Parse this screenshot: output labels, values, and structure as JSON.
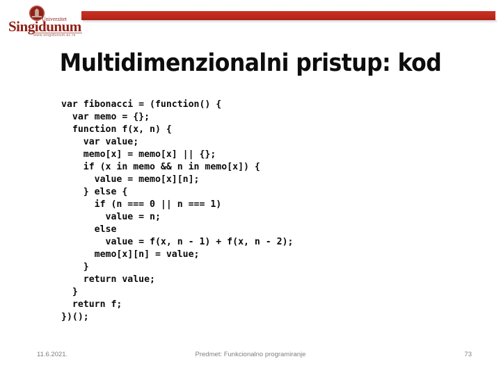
{
  "slide": {
    "title": "Multidimenzionalni pristup: kod",
    "accent_color": "#bf2a1d",
    "background_color": "#ffffff",
    "text_color": "#0d0d0d",
    "footer_color": "#7f7f7f"
  },
  "header": {
    "logo": {
      "wordmark": "Singidunum",
      "supertitle": "Univerzitet",
      "url": "www.singidunum.ac.rs",
      "emblem_icon": "university-crest-icon",
      "color": "#8f2018"
    },
    "accent_bar": {
      "color": "#bf2a1d"
    }
  },
  "code": {
    "language": "javascript",
    "lines": [
      "var fibonacci = (function() {",
      "  var memo = {};",
      "  function f(x, n) {",
      "    var value;",
      "    memo[x] = memo[x] || {};",
      "    if (x in memo && n in memo[x]) {",
      "      value = memo[x][n];",
      "    } else {",
      "      if (n === 0 || n === 1)",
      "        value = n;",
      "      else",
      "        value = f(x, n - 1) + f(x, n - 2);",
      "      memo[x][n] = value;",
      "    }",
      "    return value;",
      "  }",
      "  return f;",
      "})();"
    ]
  },
  "footer": {
    "date": "11.6.2021.",
    "subject": "Predmet: Funkcionalno programiranje",
    "page_number": "73"
  }
}
